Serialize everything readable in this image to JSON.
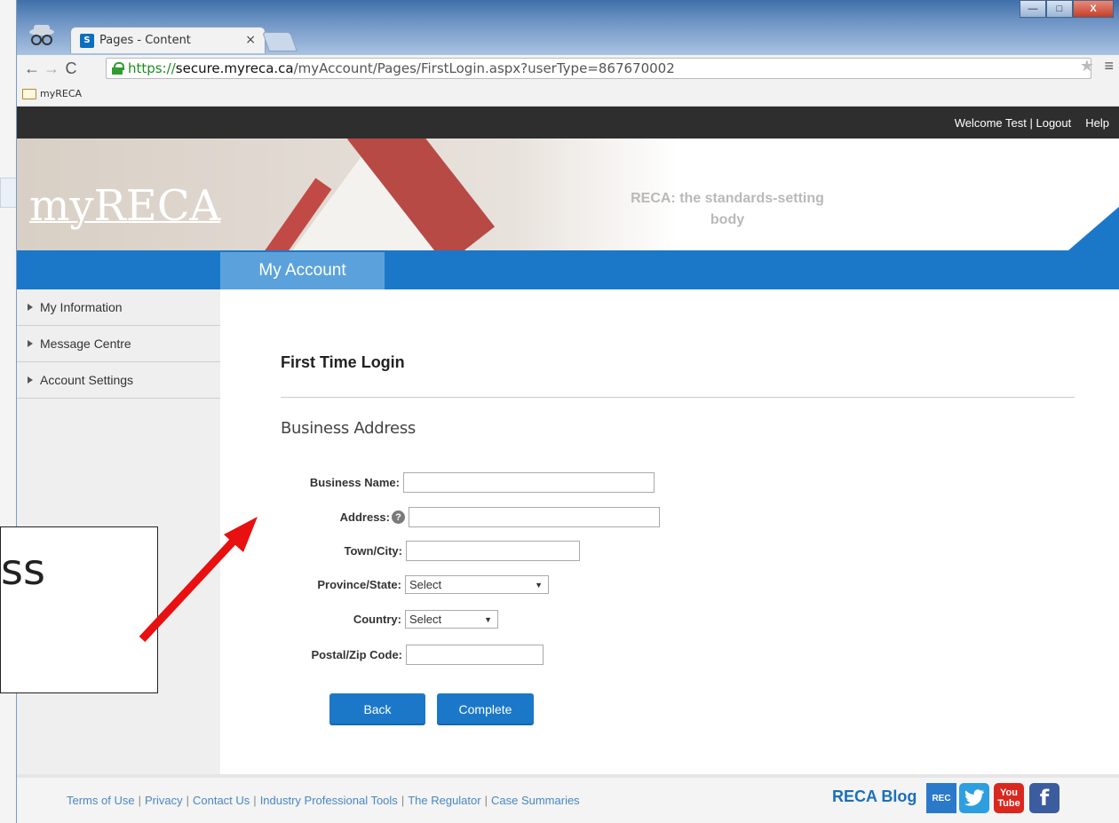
{
  "browser": {
    "tab_title": "Pages - Content",
    "tab_close": "×",
    "url_scheme": "https://",
    "url_domain": "secure.myreca.ca",
    "url_path": "/myAccount/Pages/FirstLogin.aspx?userType=867670002",
    "bookmark_folder": "myRECA",
    "window_min": "—",
    "window_max": "□",
    "window_close": "X"
  },
  "topnav": {
    "welcome": "Welcome Test | Logout",
    "help": "Help"
  },
  "banner": {
    "logo": "myRECA",
    "tagline": "RECA: the standards-setting body"
  },
  "nav": {
    "active_tab": "My Account"
  },
  "sidebar": {
    "items": [
      {
        "label": "My Information"
      },
      {
        "label": "Message Centre"
      },
      {
        "label": "Account Settings"
      }
    ]
  },
  "form": {
    "page_title": "First Time Login",
    "section_title": "Business Address",
    "fields": {
      "business_name": {
        "label": "Business Name:",
        "value": ""
      },
      "address": {
        "label": "Address:",
        "value": ""
      },
      "town_city": {
        "label": "Town/City:",
        "value": ""
      },
      "province_state": {
        "label": "Province/State:",
        "selected": "Select"
      },
      "country": {
        "label": "Country:",
        "selected": "Select"
      },
      "postal_code": {
        "label": "Postal/Zip Code:",
        "value": ""
      }
    },
    "back_label": "Back",
    "complete_label": "Complete"
  },
  "footer": {
    "links": [
      "Terms of Use",
      "Privacy",
      "Contact Us",
      "Industry Professional Tools",
      "The Regulator",
      "Case Summaries"
    ],
    "blog_label": "RECA Blog",
    "reca_icon_text": "REC",
    "youtube_text_top": "You",
    "youtube_text_bottom": "Tube",
    "facebook_text": "f"
  },
  "annotation": {
    "callout_text": "ss"
  },
  "colors": {
    "brand_blue": "#1b78c9",
    "tab_blue": "#5ba2dd",
    "topbar": "#2e2e2e",
    "arrow_red": "#e81010"
  }
}
